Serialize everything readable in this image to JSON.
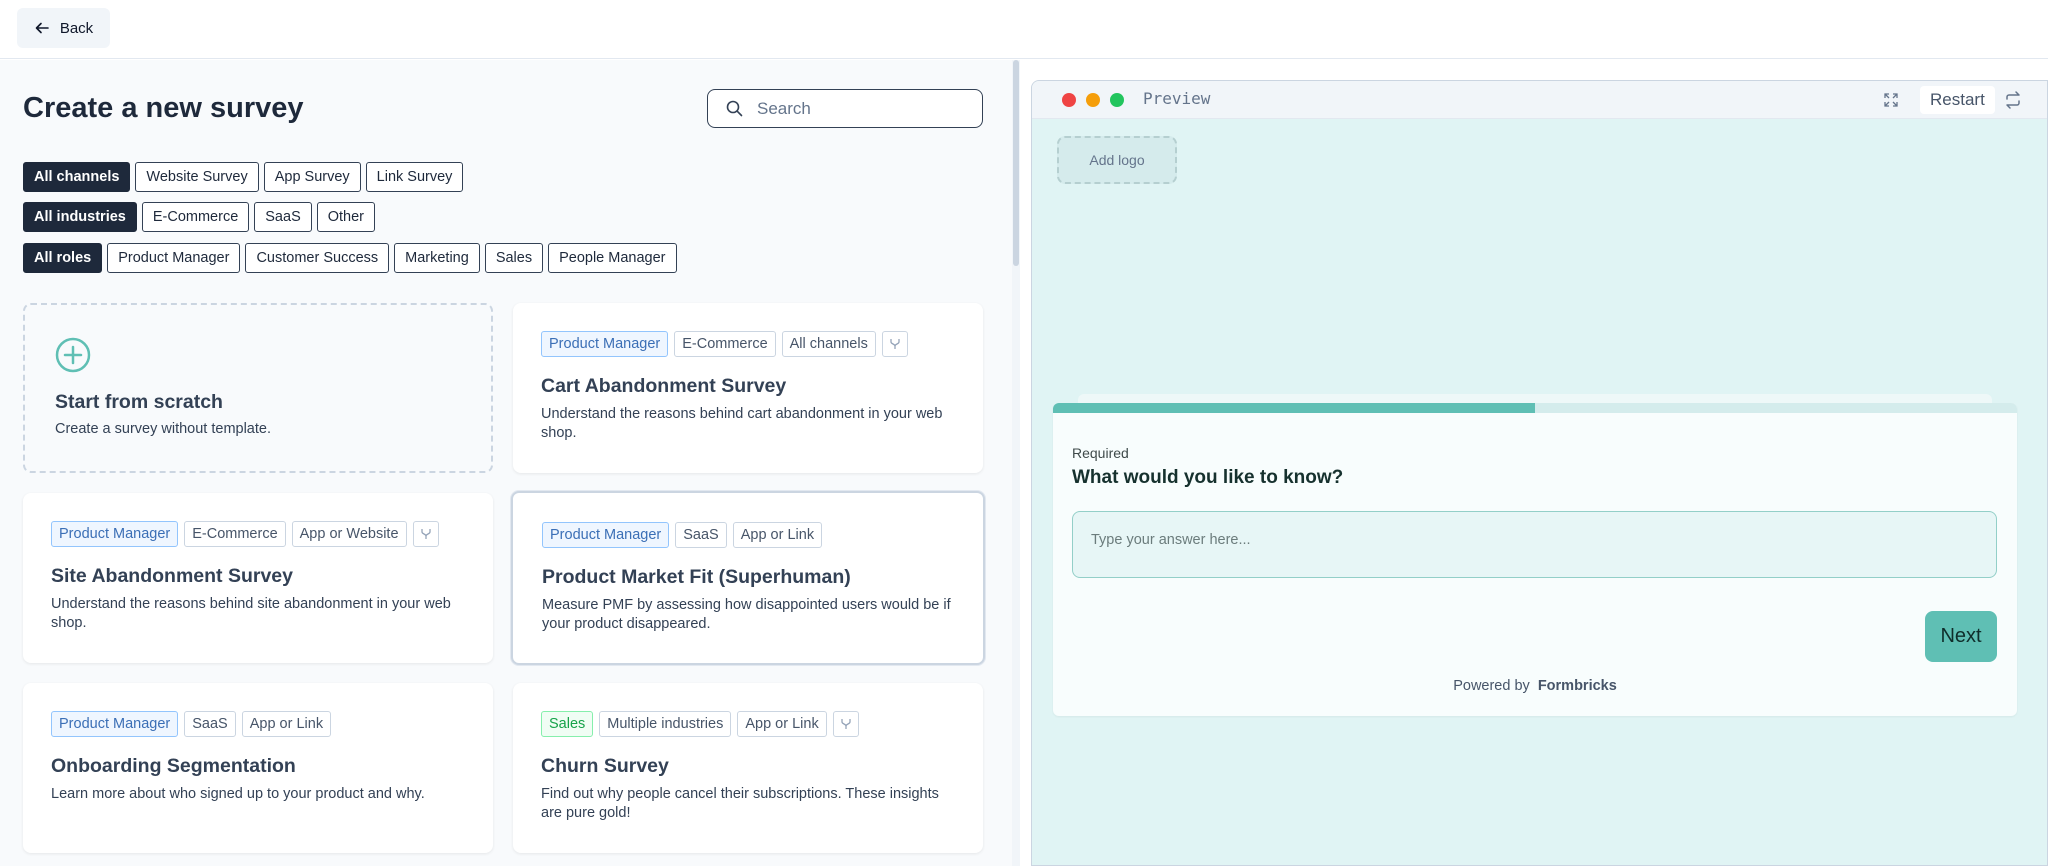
{
  "topbar": {
    "back_label": "Back"
  },
  "left": {
    "title": "Create a new survey",
    "search": {
      "placeholder": "Search"
    },
    "filters": {
      "channels": [
        "All channels",
        "Website Survey",
        "App Survey",
        "Link Survey"
      ],
      "industries": [
        "All industries",
        "E-Commerce",
        "SaaS",
        "Other"
      ],
      "roles": [
        "All roles",
        "Product Manager",
        "Customer Success",
        "Marketing",
        "Sales",
        "People Manager"
      ]
    },
    "scratch": {
      "title": "Start from scratch",
      "desc": "Create a survey without template."
    },
    "templates": [
      {
        "tags": [
          "Product Manager",
          "E-Commerce",
          "All channels"
        ],
        "title": "Cart Abandonment Survey",
        "desc": "Understand the reasons behind cart abandonment in your web shop."
      },
      {
        "tags": [
          "Product Manager",
          "E-Commerce",
          "App or Website"
        ],
        "title": "Site Abandonment Survey",
        "desc": "Understand the reasons behind site abandonment in your web shop."
      },
      {
        "tags": [
          "Product Manager",
          "SaaS",
          "App or Link"
        ],
        "title": "Product Market Fit (Superhuman)",
        "desc": "Measure PMF by assessing how disappointed users would be if your product disappeared."
      },
      {
        "tags": [
          "Product Manager",
          "SaaS",
          "App or Link"
        ],
        "title": "Onboarding Segmentation",
        "desc": "Learn more about who signed up to your product and why."
      },
      {
        "tags": [
          "Sales",
          "Multiple industries",
          "App or Link"
        ],
        "title": "Churn Survey",
        "desc": "Find out why people cancel their subscriptions. These insights are pure gold!"
      }
    ]
  },
  "preview": {
    "label": "Preview",
    "restart_label": "Restart",
    "add_logo": "Add logo",
    "progress": 0.5,
    "required": "Required",
    "question": "What would you like to know?",
    "answer_placeholder": "Type your answer here...",
    "next_label": "Next",
    "powered_prefix": "Powered by",
    "powered_brand": "Formbricks"
  },
  "colors": {
    "accent": "#5fbfb4",
    "dark": "#1e293b",
    "preview_bg": "#e0f4f4"
  }
}
